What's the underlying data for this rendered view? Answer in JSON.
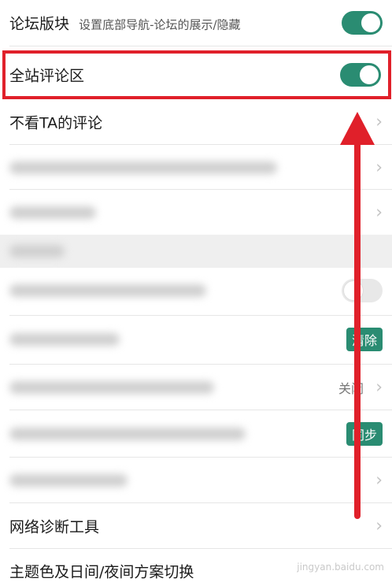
{
  "settings": {
    "forum": {
      "label": "论坛版块",
      "sub": "设置底部导航-论坛的展示/隐藏",
      "state": "on"
    },
    "site_comments": {
      "label": "全站评论区",
      "state": "on"
    },
    "ignore_comments": {
      "label": "不看TA的评论"
    },
    "network_diagnostics": {
      "label": "网络诊断工具"
    },
    "theme_switch": {
      "label": "主题色及日间/夜间方案切换"
    }
  },
  "blurred_rows": {
    "clear_badge": "清除",
    "close_value": "关闭",
    "sync_badge": "同步"
  },
  "watermark": "jingyan.baidu.com",
  "colors": {
    "accent": "#2a8c72",
    "highlight_red": "#e0202a",
    "arrow_red": "#e0202a"
  }
}
